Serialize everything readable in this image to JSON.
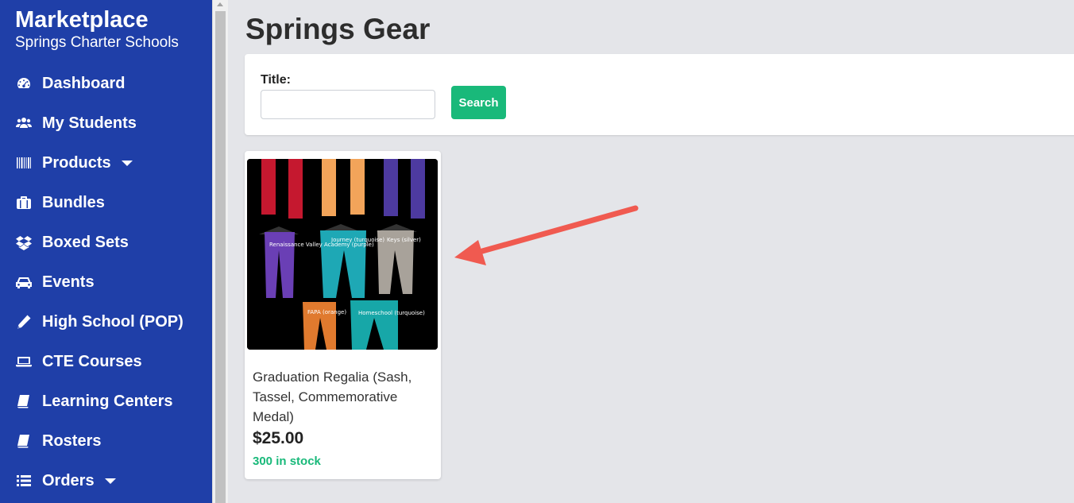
{
  "sidebar": {
    "title": "Marketplace",
    "subtitle": "Springs Charter Schools",
    "items": [
      {
        "label": "Dashboard",
        "icon": "dashboard-icon"
      },
      {
        "label": "My Students",
        "icon": "users-icon"
      },
      {
        "label": "Products",
        "icon": "barcode-icon",
        "has_dropdown": true
      },
      {
        "label": "Bundles",
        "icon": "briefcase-icon"
      },
      {
        "label": "Boxed Sets",
        "icon": "dropbox-icon"
      },
      {
        "label": "Events",
        "icon": "car-icon"
      },
      {
        "label": "High School (POP)",
        "icon": "pencil-icon"
      },
      {
        "label": "CTE Courses",
        "icon": "laptop-icon"
      },
      {
        "label": "Learning Centers",
        "icon": "book-icon"
      },
      {
        "label": "Rosters",
        "icon": "book-icon"
      },
      {
        "label": "Orders",
        "icon": "list-icon",
        "has_dropdown": true
      }
    ]
  },
  "main": {
    "title": "Springs Gear",
    "search": {
      "label": "Title:",
      "value": "",
      "placeholder": "",
      "button_label": "Search"
    },
    "products": [
      {
        "name": "Graduation Regalia (Sash, Tassel, Commemorative Medal)",
        "price": "$25.00",
        "stock": "300 in stock",
        "image_labels": [
          "Renaissance Valley Academy (purple)",
          "Journey (turquoise)",
          "Keys (silver)",
          "FAPA (orange)",
          "Homeschool (turquoise)"
        ]
      }
    ]
  },
  "colors": {
    "sidebar_bg": "#1f3fa8",
    "accent_green": "#19b97a",
    "page_bg": "#e4e5e9",
    "annotation_arrow": "#f05a50"
  }
}
